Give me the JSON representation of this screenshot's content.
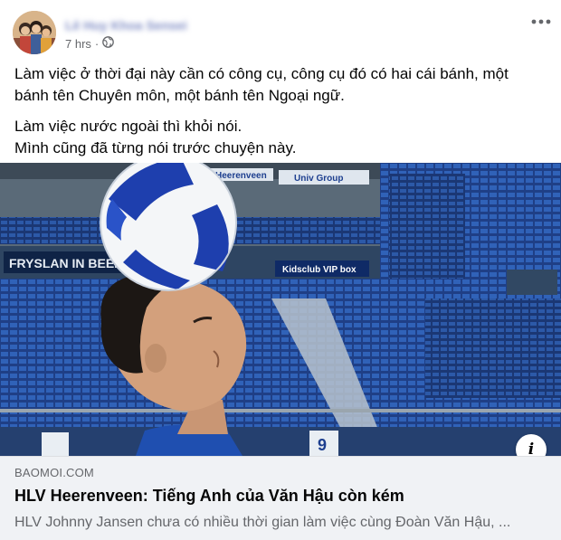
{
  "post": {
    "author": "Lê Huy Khoa Sensei",
    "time": "7 hrs",
    "privacy_dot": "·",
    "privacy_icon": "globe-icon",
    "more_icon": "more-horizontal-icon",
    "text_lines": [
      "Làm việc ở thời đại này cần có công cụ, công cụ đó có hai cái bánh, một",
      "bánh tên Chuyên môn, một bánh tên Ngoại ngữ.",
      "Làm việc nước ngoài thì khỏi nói.",
      "Mình cũng đã từng nói trước chuyện này."
    ]
  },
  "photo": {
    "signs": [
      "Heerenveen",
      "Univ Group",
      "FRYSLAN IN BEELD",
      "Kidsclub VIP box",
      "9"
    ]
  },
  "link_card": {
    "domain": "BAOMOI.COM",
    "headline": "HLV Heerenveen: Tiếng Anh của Văn Hậu còn kém",
    "description": "HLV Johnny Jansen chưa có nhiều thời gian làm việc cùng Đoàn Văn Hậu, ...",
    "info_label": "i"
  },
  "colors": {
    "accent": "#1877f2",
    "secondary_text": "#65676b",
    "card_bg": "#f0f2f5",
    "stadium_seat": "#2b4f9a"
  }
}
